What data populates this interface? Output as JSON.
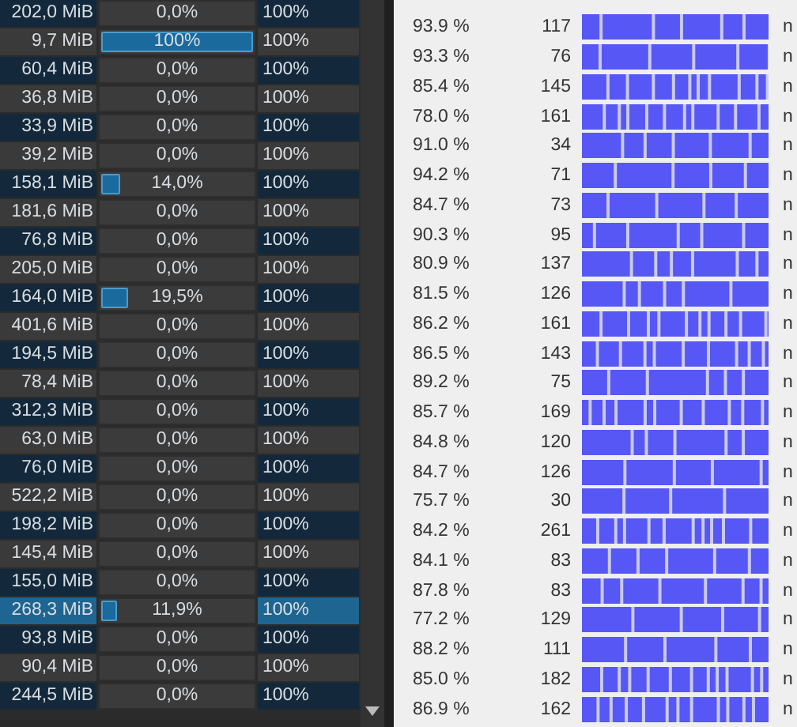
{
  "processes": [
    {
      "memory": "202,0 MiB",
      "cpu": "0,0%",
      "limit": "100%",
      "selected": false
    },
    {
      "memory": "9,7 MiB",
      "cpu": "100%",
      "level": 1,
      "limit": "100%",
      "selected": false
    },
    {
      "memory": "60,4 MiB",
      "cpu": "0,0%",
      "limit": "100%",
      "selected": false
    },
    {
      "memory": "36,8 MiB",
      "cpu": "0,0%",
      "limit": "100%",
      "selected": false
    },
    {
      "memory": "33,9 MiB",
      "cpu": "0,0%",
      "limit": "100%",
      "selected": false
    },
    {
      "memory": "39,2 MiB",
      "cpu": "0,0%",
      "limit": "100%",
      "selected": false
    },
    {
      "memory": "158,1 MiB",
      "cpu": "14,0%",
      "level": 0.14,
      "limit": "100%",
      "selected": false
    },
    {
      "memory": "181,6 MiB",
      "cpu": "0,0%",
      "limit": "100%",
      "selected": false
    },
    {
      "memory": "76,8 MiB",
      "cpu": "0,0%",
      "limit": "100%",
      "selected": false
    },
    {
      "memory": "205,0 MiB",
      "cpu": "0,0%",
      "limit": "100%",
      "selected": false
    },
    {
      "memory": "164,0 MiB",
      "cpu": "19,5%",
      "level": 0.195,
      "limit": "100%",
      "selected": false
    },
    {
      "memory": "401,6 MiB",
      "cpu": "0,0%",
      "limit": "100%",
      "selected": false
    },
    {
      "memory": "194,5 MiB",
      "cpu": "0,0%",
      "limit": "100%",
      "selected": false
    },
    {
      "memory": "78,4 MiB",
      "cpu": "0,0%",
      "limit": "100%",
      "selected": false
    },
    {
      "memory": "312,3 MiB",
      "cpu": "0,0%",
      "limit": "100%",
      "selected": false
    },
    {
      "memory": "63,0 MiB",
      "cpu": "0,0%",
      "limit": "100%",
      "selected": false
    },
    {
      "memory": "76,0 MiB",
      "cpu": "0,0%",
      "limit": "100%",
      "selected": false
    },
    {
      "memory": "522,2 MiB",
      "cpu": "0,0%",
      "limit": "100%",
      "selected": false
    },
    {
      "memory": "198,2 MiB",
      "cpu": "0,0%",
      "limit": "100%",
      "selected": false
    },
    {
      "memory": "145,4 MiB",
      "cpu": "0,0%",
      "limit": "100%",
      "selected": false
    },
    {
      "memory": "155,0 MiB",
      "cpu": "0,0%",
      "limit": "100%",
      "selected": false
    },
    {
      "memory": "268,3 MiB",
      "cpu": "11,9%",
      "level": 0.119,
      "limit": "100%",
      "selected": true
    },
    {
      "memory": "93,8 MiB",
      "cpu": "0,0%",
      "limit": "100%",
      "selected": false
    },
    {
      "memory": "90,4 MiB",
      "cpu": "0,0%",
      "limit": "100%",
      "selected": false
    },
    {
      "memory": "244,5 MiB",
      "cpu": "0,0%",
      "limit": "100%",
      "selected": false
    }
  ],
  "samples": [
    {
      "percent": "93.9 %",
      "count": "117",
      "status": "n"
    },
    {
      "percent": "93.3 %",
      "count": "76",
      "status": "n"
    },
    {
      "percent": "85.4 %",
      "count": "145",
      "status": "n"
    },
    {
      "percent": "78.0 %",
      "count": "161",
      "status": "n"
    },
    {
      "percent": "91.0 %",
      "count": "34",
      "status": "n"
    },
    {
      "percent": "94.2 %",
      "count": "71",
      "status": "n"
    },
    {
      "percent": "84.7 %",
      "count": "73",
      "status": "n"
    },
    {
      "percent": "90.3 %",
      "count": "95",
      "status": "n"
    },
    {
      "percent": "80.9 %",
      "count": "137",
      "status": "n"
    },
    {
      "percent": "81.5 %",
      "count": "126",
      "status": "n"
    },
    {
      "percent": "86.2 %",
      "count": "161",
      "status": "n"
    },
    {
      "percent": "86.5 %",
      "count": "143",
      "status": "n"
    },
    {
      "percent": "89.2 %",
      "count": "75",
      "status": "n"
    },
    {
      "percent": "85.7 %",
      "count": "169",
      "status": "n"
    },
    {
      "percent": "84.8 %",
      "count": "120",
      "status": "n"
    },
    {
      "percent": "84.7 %",
      "count": "126",
      "status": "n"
    },
    {
      "percent": "75.7 %",
      "count": "30",
      "status": "n"
    },
    {
      "percent": "84.2 %",
      "count": "261",
      "status": "n"
    },
    {
      "percent": "84.1 %",
      "count": "83",
      "status": "n"
    },
    {
      "percent": "87.8 %",
      "count": "83",
      "status": "n"
    },
    {
      "percent": "77.2 %",
      "count": "129",
      "status": "n"
    },
    {
      "percent": "88.2 %",
      "count": "111",
      "status": "n"
    },
    {
      "percent": "85.0 %",
      "count": "182",
      "status": "n"
    },
    {
      "percent": "86.9 %",
      "count": "162",
      "status": "n"
    }
  ]
}
